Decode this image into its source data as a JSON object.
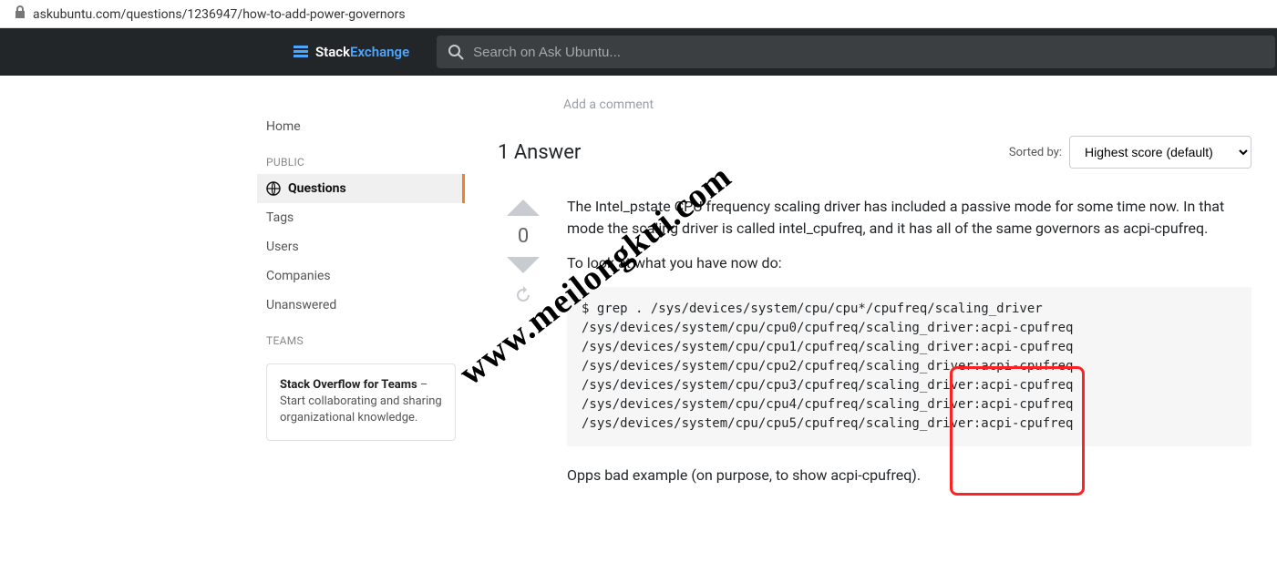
{
  "url": "askubuntu.com/questions/1236947/how-to-add-power-governors",
  "brand": {
    "prefix": "Stack",
    "suffix": "Exchange"
  },
  "search": {
    "placeholder": "Search on Ask Ubuntu..."
  },
  "sidebar": {
    "home": "Home",
    "public_label": "PUBLIC",
    "questions": "Questions",
    "tags": "Tags",
    "users": "Users",
    "companies": "Companies",
    "unanswered": "Unanswered",
    "teams_label": "TEAMS",
    "teams_card_title": "Stack Overflow for Teams",
    "teams_card_rest": " – Start collaborating and sharing organizational knowledge."
  },
  "content": {
    "add_comment": "Add a comment",
    "answers_heading": "1 Answer",
    "sort_label": "Sorted by:",
    "sort_value": "Highest score (default)",
    "vote_count": "0",
    "para1": "The Intel_pstate CPU frequency scaling driver has included a passive mode for some time now. In that mode the scaling driver is called intel_cpufreq, and it has all of the same governors as acpi-cpufreq.",
    "para2": "To look at what you have now do:",
    "code": "$ grep . /sys/devices/system/cpu/cpu*/cpufreq/scaling_driver\n/sys/devices/system/cpu/cpu0/cpufreq/scaling_driver:acpi-cpufreq\n/sys/devices/system/cpu/cpu1/cpufreq/scaling_driver:acpi-cpufreq\n/sys/devices/system/cpu/cpu2/cpufreq/scaling_driver:acpi-cpufreq\n/sys/devices/system/cpu/cpu3/cpufreq/scaling_driver:acpi-cpufreq\n/sys/devices/system/cpu/cpu4/cpufreq/scaling_driver:acpi-cpufreq\n/sys/devices/system/cpu/cpu5/cpufreq/scaling_driver:acpi-cpufreq",
    "para3": "Opps bad example (on purpose, to show acpi-cpufreq)."
  },
  "watermark": "www.meilongkui.com"
}
